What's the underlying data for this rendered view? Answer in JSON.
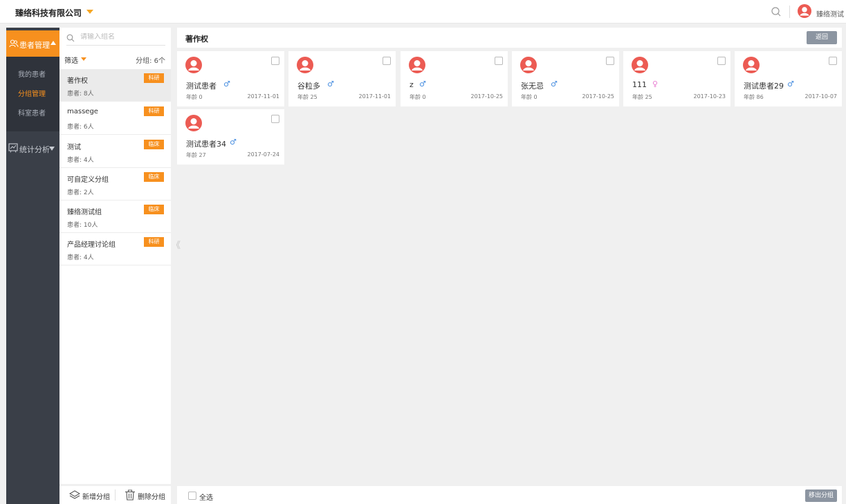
{
  "header": {
    "company": "臻络科技有限公司",
    "user_name": "臻络测试",
    "icons": [
      "caret-down-icon",
      "search-icon",
      "avatar-icon"
    ]
  },
  "sidebar": {
    "section_label": "患者管理",
    "items": [
      {
        "label": "我的患者",
        "active": false
      },
      {
        "label": "分组管理",
        "active": true
      },
      {
        "label": "科室患者",
        "active": false
      }
    ],
    "stats_label": "统计分析",
    "accent_color": "#f7901e"
  },
  "groups": {
    "search_placeholder": "请输入组名",
    "filter_label": "筛选",
    "count_label": "分组: 6个",
    "items": [
      {
        "name": "著作权",
        "count": "患者: 8人",
        "tag": "科研",
        "selected": true
      },
      {
        "name": "massege",
        "count": "患者: 6人",
        "tag": "科研",
        "selected": false
      },
      {
        "name": "测试",
        "count": "患者: 4人",
        "tag": "临床",
        "selected": false
      },
      {
        "name": "可自定义分组",
        "count": "患者: 2人",
        "tag": "临床",
        "selected": false
      },
      {
        "name": "臻络测试组",
        "count": "患者: 10人",
        "tag": "临床",
        "selected": false
      },
      {
        "name": "产品经理讨论组",
        "count": "患者: 4人",
        "tag": "科研",
        "selected": false
      }
    ],
    "add_label": "新增分组",
    "delete_label": "删除分组",
    "collapse_glyph": "《"
  },
  "main": {
    "title": "著作权",
    "back_label": "返回",
    "patients": [
      {
        "name": "测试患者",
        "sex": "♂",
        "gender": "male",
        "age": "年龄 0",
        "date": "2017-11-01"
      },
      {
        "name": "谷粒多",
        "sex": "♂",
        "gender": "male",
        "age": "年龄 25",
        "date": "2017-11-01"
      },
      {
        "name": "z",
        "sex": "♂",
        "gender": "male",
        "age": "年龄 0",
        "date": "2017-10-25"
      },
      {
        "name": "张无忌",
        "sex": "♂",
        "gender": "male",
        "age": "年龄 0",
        "date": "2017-10-25"
      },
      {
        "name": "111",
        "sex": "♀",
        "gender": "female",
        "age": "年龄 25",
        "date": "2017-10-23"
      },
      {
        "name": "测试患者29",
        "sex": "♂",
        "gender": "male",
        "age": "年龄 86",
        "date": "2017-10-07"
      },
      {
        "name": "测试患者34",
        "sex": "♂",
        "gender": "male",
        "age": "年龄 27",
        "date": "2017-07-24"
      }
    ],
    "select_all_label": "全选",
    "move_out_label": "移出分组"
  }
}
